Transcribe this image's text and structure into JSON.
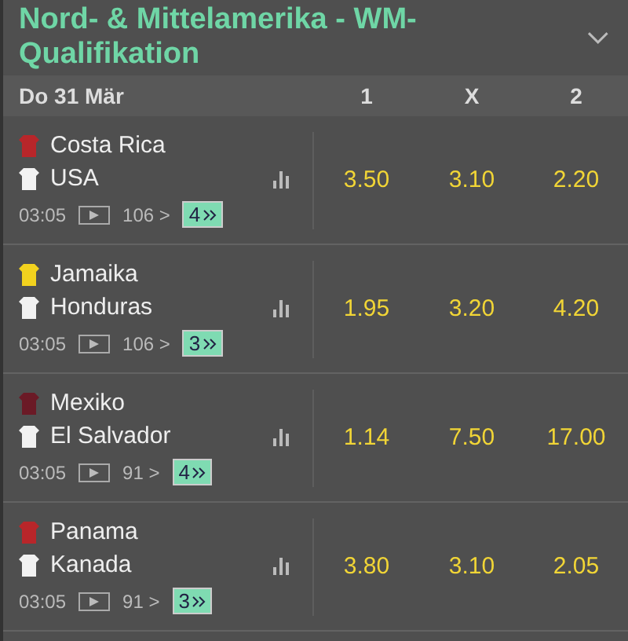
{
  "title": "Nord- & Mittelamerika - WM-Qualifikation",
  "date": "Do 31 Mär",
  "columns": [
    "1",
    "X",
    "2"
  ],
  "matches": [
    {
      "teams": [
        {
          "name": "Costa Rica",
          "color": "#b8262a"
        },
        {
          "name": "USA",
          "color": "#f2f2f2"
        }
      ],
      "time": "03:05",
      "markets": "106 >",
      "extra": "4",
      "odds": [
        "3.50",
        "3.10",
        "2.20"
      ]
    },
    {
      "teams": [
        {
          "name": "Jamaika",
          "color": "#f2d21e"
        },
        {
          "name": "Honduras",
          "color": "#f2f2f2"
        }
      ],
      "time": "03:05",
      "markets": "106 >",
      "extra": "3",
      "odds": [
        "1.95",
        "3.20",
        "4.20"
      ]
    },
    {
      "teams": [
        {
          "name": "Mexiko",
          "color": "#6b1a26"
        },
        {
          "name": "El Salvador",
          "color": "#f2f2f2"
        }
      ],
      "time": "03:05",
      "markets": "91 >",
      "extra": "4",
      "odds": [
        "1.14",
        "7.50",
        "17.00"
      ]
    },
    {
      "teams": [
        {
          "name": "Panama",
          "color": "#b8262a"
        },
        {
          "name": "Kanada",
          "color": "#f2f2f2"
        }
      ],
      "time": "03:05",
      "markets": "91 >",
      "extra": "3",
      "odds": [
        "3.80",
        "3.10",
        "2.05"
      ]
    }
  ]
}
